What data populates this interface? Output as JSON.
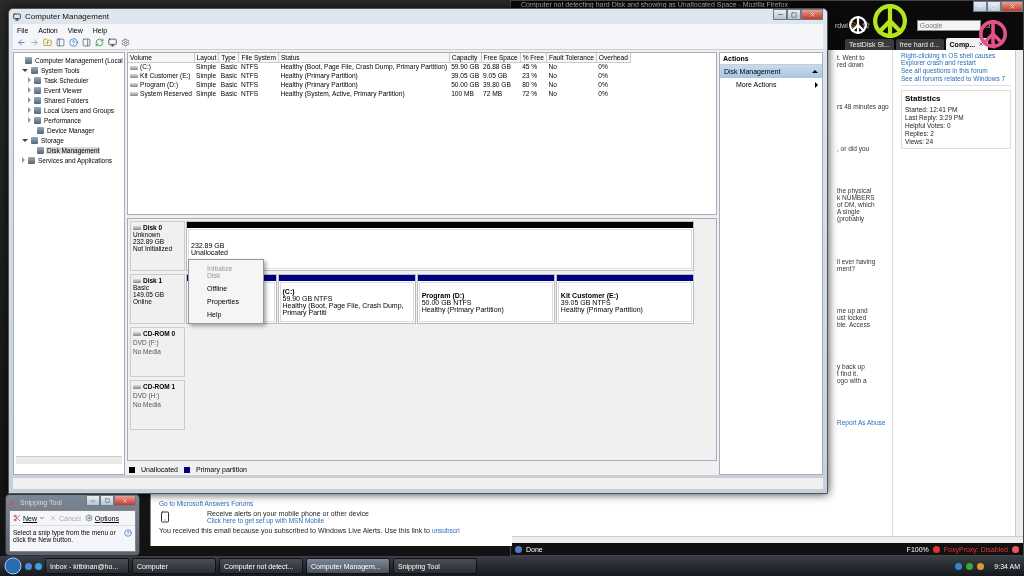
{
  "browser": {
    "title": "Computer not detecting hard Disk and showing as Unallocated Space - Mozilla Firefox",
    "address_fragment": "rdwi",
    "search_placeholder": "Google",
    "tabs": [
      {
        "label": "TestDisk St...",
        "selected": false
      },
      {
        "label": "free hard d...",
        "selected": false
      },
      {
        "label": "Comp...",
        "selected": true
      }
    ],
    "fragment_blocks": [
      [
        "t. Went to",
        "red down"
      ],
      [
        "rs 48 minutes ago"
      ],
      [
        ", or did you"
      ],
      [
        "the physical",
        "k NUMBERS",
        "of DM, which",
        "A single",
        "(probably"
      ],
      [
        "ll ever having",
        "ment?"
      ],
      [
        "me up and",
        "ust locked",
        "ble. Access"
      ],
      [
        "y back up",
        "t find it.",
        "ogo with a"
      ],
      [
        "Report As Abuse"
      ]
    ],
    "related_link": "Right-clicking in OS shell causes Explorer crash and restart",
    "forum_links": [
      "See all questions in this forum",
      "See all forums related to Windows 7"
    ],
    "statistics": {
      "title": "Statistics",
      "rows": [
        {
          "label": "Started:",
          "value": "12:41 PM"
        },
        {
          "label": "Last Reply:",
          "value": "3:29 PM"
        },
        {
          "label": "Helpful Votes:",
          "value": "0"
        },
        {
          "label": "Replies:",
          "value": "2"
        },
        {
          "label": "Views:",
          "value": "24"
        }
      ]
    },
    "status_bar": {
      "text": "Done",
      "zoom": "F100%",
      "proxy": "FoxyProxy: Disabled"
    }
  },
  "mail": {
    "forum_link": "Go to Microsoft Answers Forums",
    "alert_text": "Receive alerts on your mobile phone or other device",
    "alert_link": "Click here to get set up with MSN Mobile",
    "footer": "You received this email because you subscribed to Windows Live Alerts. Use this link to",
    "footer_link": "unsubscri"
  },
  "window": {
    "title": "Computer Management",
    "menu": [
      "File",
      "Action",
      "View",
      "Help"
    ],
    "tree": [
      {
        "label": "Computer Management (Local",
        "selected": false,
        "children": [
          {
            "label": "System Tools",
            "expanded": true,
            "selected": false,
            "children": [
              {
                "label": "Task Scheduler",
                "expanded": false,
                "selected": false
              },
              {
                "label": "Event Viewer",
                "expanded": false,
                "selected": false
              },
              {
                "label": "Shared Folders",
                "expanded": false,
                "selected": false
              },
              {
                "label": "Local Users and Groups",
                "expanded": false,
                "selected": false
              },
              {
                "label": "Performance",
                "expanded": false,
                "selected": false
              },
              {
                "label": "Device Manager",
                "selected": false
              }
            ]
          },
          {
            "label": "Storage",
            "expanded": true,
            "selected": false,
            "children": [
              {
                "label": "Disk Management",
                "selected": true
              }
            ]
          },
          {
            "label": "Services and Applications",
            "expanded": false,
            "selected": false
          }
        ]
      }
    ],
    "volumes": {
      "columns": [
        "Volume",
        "Layout",
        "Type",
        "File System",
        "Status",
        "Capacity",
        "Free Space",
        "% Free",
        "Fault Tolerance",
        "Overhead"
      ],
      "rows": [
        [
          "(C:)",
          "Simple",
          "Basic",
          "NTFS",
          "Healthy (Boot, Page File, Crash Dump, Primary Partition)",
          "59.90 GB",
          "26.88 GB",
          "45 %",
          "No",
          "0%"
        ],
        [
          "Kit Customer (E:)",
          "Simple",
          "Basic",
          "NTFS",
          "Healthy (Primary Partition)",
          "39.05 GB",
          "9.05 GB",
          "23 %",
          "No",
          "0%"
        ],
        [
          "Program (D:)",
          "Simple",
          "Basic",
          "NTFS",
          "Healthy (Primary Partition)",
          "50.00 GB",
          "39.80 GB",
          "80 %",
          "No",
          "0%"
        ],
        [
          "System Reserved",
          "Simple",
          "Basic",
          "NTFS",
          "Healthy (System, Active, Primary Partition)",
          "100 MB",
          "72 MB",
          "72 %",
          "No",
          "0%"
        ]
      ]
    },
    "disks": [
      {
        "kind": "disk",
        "name": "Disk 0",
        "lines": [
          "Unknown",
          "232.89 GB",
          "Not Initialized"
        ],
        "partitions": [
          {
            "kind": "unallocated",
            "lines": [
              "232.89 GB",
              "Unallocated"
            ]
          }
        ]
      },
      {
        "kind": "disk",
        "name": "Disk 1",
        "lines": [
          "Basic",
          "149.05 GB",
          "Online"
        ],
        "partitions": [
          {
            "kind": "reserved"
          },
          {
            "kind": "primary",
            "name": "(C:)",
            "lines": [
              "59.90 GB NTFS",
              "Healthy (Boot, Page File, Crash Dump, Primary Partiti"
            ]
          },
          {
            "kind": "primary",
            "name": "Program  (D:)",
            "lines": [
              "50.00 GB NTFS",
              "Healthy (Primary Partition)"
            ]
          },
          {
            "kind": "primary",
            "name": "Kit Customer  (E:)",
            "lines": [
              "39.05 GB NTFS",
              "Healthy (Primary Partition)"
            ]
          }
        ]
      },
      {
        "kind": "cdrom",
        "name": "CD-ROM 0",
        "lines": [
          "DVD (F:)",
          "No Media"
        ]
      },
      {
        "kind": "cdrom",
        "name": "CD-ROM 1",
        "lines": [
          "DVD (H:)",
          "No Media"
        ]
      }
    ],
    "legend": [
      {
        "label": "Unallocated",
        "color": "#000000"
      },
      {
        "label": "Primary partition",
        "color": "#000080"
      }
    ],
    "context_menu": [
      {
        "label": "Initialize Disk",
        "disabled": true
      },
      {
        "label": "Offline",
        "disabled": false
      },
      {
        "label": "Properties",
        "disabled": false
      },
      {
        "label": "Help",
        "disabled": false
      }
    ],
    "actions": {
      "title": "Actions",
      "section": {
        "label": "Disk Management",
        "selected": true
      },
      "items": [
        "More Actions"
      ]
    }
  },
  "snipping_tool": {
    "title": "Snipping Tool",
    "buttons": [
      {
        "label": "New",
        "disabled": false
      },
      {
        "label": "Cancel",
        "disabled": true
      },
      {
        "label": "Options",
        "disabled": false
      }
    ],
    "hint": "Select a snip type from the menu or click the New button."
  },
  "taskbar": {
    "items": [
      {
        "label": "Inbox - kitbinan@ho...",
        "selected": false
      },
      {
        "label": "Computer",
        "selected": false
      },
      {
        "label": "Computer not detect...",
        "selected": false
      },
      {
        "label": "Computer Managem...",
        "selected": true
      },
      {
        "label": "Snipping Tool",
        "selected": false
      }
    ],
    "clock": "9:34 AM"
  }
}
